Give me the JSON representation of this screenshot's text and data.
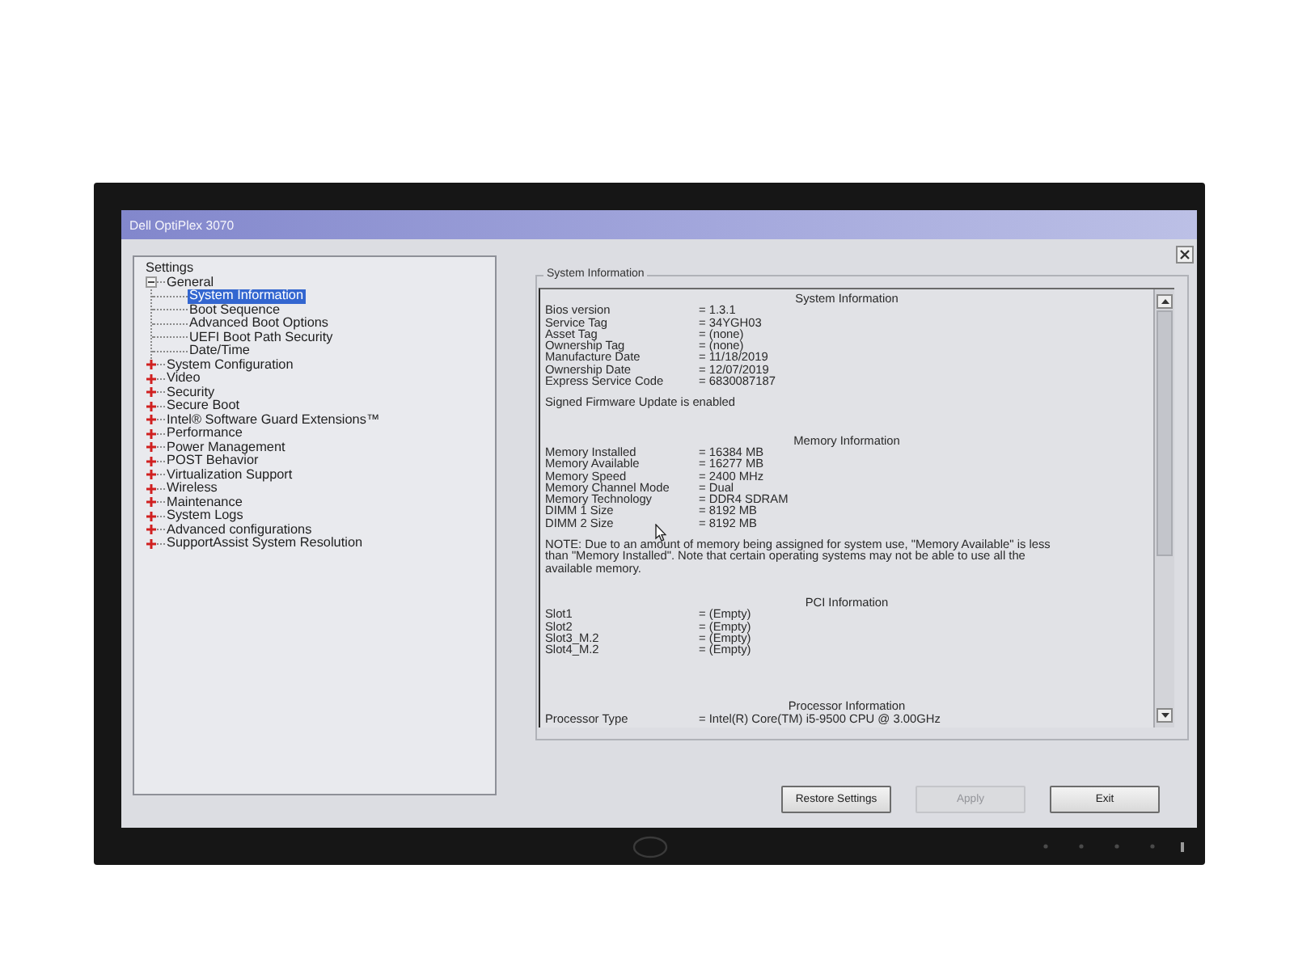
{
  "window": {
    "title": "Dell OptiPlex 3070"
  },
  "settings_tree": {
    "root": "Settings",
    "items": [
      {
        "label": "General",
        "expanded": true,
        "selected": false,
        "children": [
          {
            "label": "System Information",
            "selected": true
          },
          {
            "label": "Boot Sequence",
            "selected": false
          },
          {
            "label": "Advanced Boot Options",
            "selected": false
          },
          {
            "label": "UEFI Boot Path Security",
            "selected": false
          },
          {
            "label": "Date/Time",
            "selected": false
          }
        ]
      },
      {
        "label": "System Configuration",
        "expanded": false,
        "selected": false
      },
      {
        "label": "Video",
        "expanded": false,
        "selected": false
      },
      {
        "label": "Security",
        "expanded": false,
        "selected": false
      },
      {
        "label": "Secure Boot",
        "expanded": false,
        "selected": false
      },
      {
        "label": "Intel® Software Guard Extensions™",
        "expanded": false,
        "selected": false
      },
      {
        "label": "Performance",
        "expanded": false,
        "selected": false
      },
      {
        "label": "Power Management",
        "expanded": false,
        "selected": false
      },
      {
        "label": "POST Behavior",
        "expanded": false,
        "selected": false
      },
      {
        "label": "Virtualization Support",
        "expanded": false,
        "selected": false
      },
      {
        "label": "Wireless",
        "expanded": false,
        "selected": false
      },
      {
        "label": "Maintenance",
        "expanded": false,
        "selected": false
      },
      {
        "label": "System Logs",
        "expanded": false,
        "selected": false
      },
      {
        "label": "Advanced configurations",
        "expanded": false,
        "selected": false
      },
      {
        "label": "SupportAssist System Resolution",
        "expanded": false,
        "selected": false
      }
    ]
  },
  "details": {
    "title": "System Information",
    "sections": [
      {
        "heading": "System Information",
        "rows": [
          {
            "label": "Bios version",
            "value": "= 1.3.1"
          },
          {
            "label": "Service Tag",
            "value": "= 34YGH03"
          },
          {
            "label": "Asset Tag",
            "value": "= (none)"
          },
          {
            "label": "Ownership Tag",
            "value": "= (none)"
          },
          {
            "label": "Manufacture Date",
            "value": "= 11/18/2019"
          },
          {
            "label": "Ownership Date",
            "value": "= 12/07/2019"
          },
          {
            "label": "Express Service Code",
            "value": "= 6830087187"
          }
        ],
        "note": "Signed Firmware Update is enabled"
      },
      {
        "heading": "Memory Information",
        "rows": [
          {
            "label": "Memory Installed",
            "value": "= 16384 MB"
          },
          {
            "label": "Memory Available",
            "value": "= 16277 MB"
          },
          {
            "label": "Memory Speed",
            "value": "= 2400 MHz"
          },
          {
            "label": "Memory Channel Mode",
            "value": "= Dual"
          },
          {
            "label": "Memory Technology",
            "value": "= DDR4 SDRAM"
          },
          {
            "label": "DIMM 1 Size",
            "value": "= 8192 MB"
          },
          {
            "label": "DIMM 2 Size",
            "value": "= 8192 MB"
          }
        ],
        "note": "NOTE: Due to an amount of memory being assigned for system use, \"Memory Available\" is less than \"Memory Installed\". Note that certain operating systems may not be able to use all the available memory."
      },
      {
        "heading": "PCI Information",
        "rows": [
          {
            "label": "Slot1",
            "value": "= (Empty)"
          },
          {
            "label": "Slot2",
            "value": "= (Empty)"
          },
          {
            "label": "Slot3_M.2",
            "value": "= (Empty)"
          },
          {
            "label": "Slot4_M.2",
            "value": "= (Empty)"
          }
        ]
      },
      {
        "heading": "Processor Information",
        "rows": [
          {
            "label": "Processor Type",
            "value": "= Intel(R) Core(TM) i5-9500 CPU @ 3.00GHz"
          }
        ]
      }
    ]
  },
  "buttons": [
    {
      "label": "Restore Settings",
      "disabled": false
    },
    {
      "label": "Apply",
      "disabled": true
    },
    {
      "label": "Exit",
      "disabled": false
    }
  ]
}
